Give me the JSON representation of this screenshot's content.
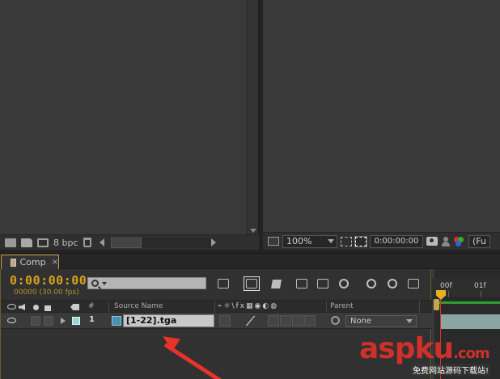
{
  "project_panel": {
    "bit_depth": "8 bpc"
  },
  "viewer": {
    "zoom": "100%",
    "timecode": "0:00:00:00",
    "resolution": "(Fu"
  },
  "timeline": {
    "tab_label": "Comp",
    "tab_close": "×",
    "timecode": "0:00:00:00",
    "fps_readout": "00000 (30.00 fps)",
    "columns": {
      "number": "#",
      "source_name": "Source Name",
      "switches": "⌁☼\\fx▦◉◐◍",
      "parent": "Parent"
    },
    "layers": [
      {
        "number": "1",
        "source_name": "[1-22].tga",
        "parent": "None"
      }
    ],
    "ruler": {
      "start": "00f",
      "mark1": "01f"
    }
  },
  "watermark": {
    "logo_main": "aspku",
    "logo_suffix": ".com",
    "tagline": "免费网站源码下载站!"
  },
  "colors": {
    "timecode": "#d8a21c",
    "cti": "#e8b020",
    "annotation_arrow": "#e8322a",
    "layer_label": "#9fd4d4"
  }
}
